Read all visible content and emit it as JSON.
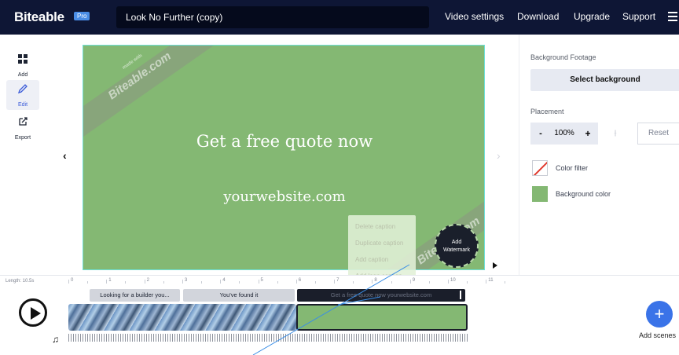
{
  "app": {
    "logo": "Biteable",
    "badge": "Pro",
    "project_title": "Look No Further (copy)"
  },
  "nav": {
    "video_settings": "Video settings",
    "download": "Download",
    "upgrade": "Upgrade",
    "support": "Support",
    "menu_icon": "hamburger-icon"
  },
  "sidebar": {
    "items": [
      {
        "label": "Add",
        "icon": "grid-icon",
        "active": false
      },
      {
        "label": "Edit",
        "icon": "pencil-icon",
        "active": true
      },
      {
        "label": "Export",
        "icon": "export-icon",
        "active": false
      }
    ]
  },
  "canvas": {
    "heading": "Get a free quote now",
    "subheading": "yourwebsite.com",
    "watermark_text": "Biteable.com",
    "watermark_small_text": "made with",
    "add_watermark": "Add\nWatermark",
    "background_color": "#84b873",
    "prev_arrow": "‹",
    "next_arrow": "›"
  },
  "context_menu": {
    "items": [
      "Delete caption",
      "Duplicate caption",
      "Add caption",
      "Add logo caption"
    ]
  },
  "right_panel": {
    "background_footage_label": "Background Footage",
    "select_background": "Select background",
    "placement_label": "Placement",
    "minus": "-",
    "scale_value": "100%",
    "plus": "+",
    "reset": "Reset",
    "color_filter": "Color filter",
    "background_color": "Background color",
    "accent_color": "#3a73e8"
  },
  "timeline": {
    "length_label": "Length: 10.5s",
    "ticks": [
      "0",
      "1",
      "2",
      "3",
      "4",
      "5",
      "6",
      "7",
      "8",
      "9",
      "10",
      "11"
    ],
    "captions": [
      "Looking for a builder you...",
      "You've found it",
      "Get a free quote now yourwebsite.com"
    ],
    "add_scene_label": "Add scenes"
  }
}
